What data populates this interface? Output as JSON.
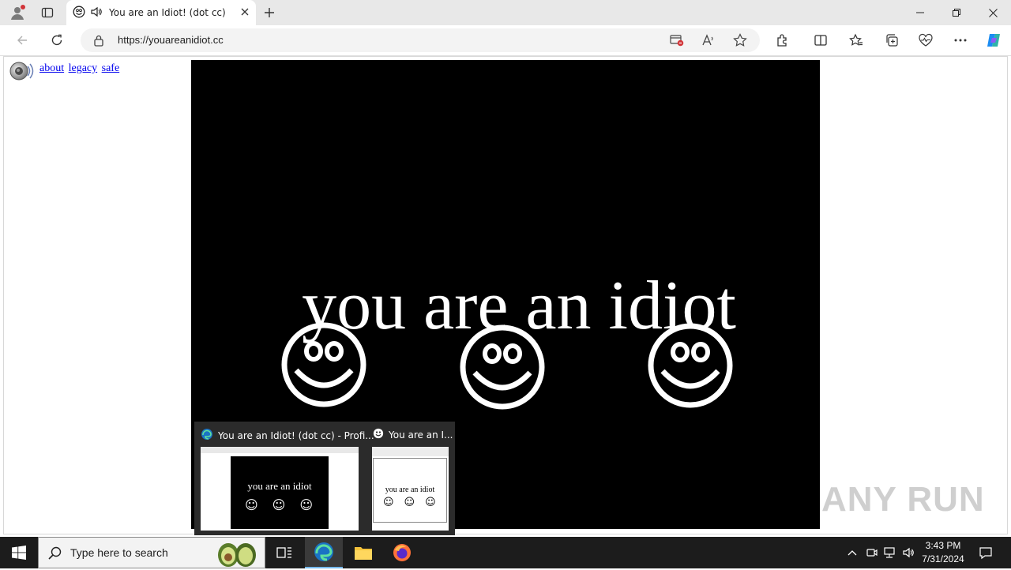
{
  "browser": {
    "tab": {
      "title": "You are an Idiot! (dot cc)"
    },
    "address": {
      "url": "https://youareanidiot.cc"
    }
  },
  "page": {
    "links": [
      "about",
      "legacy",
      "safe"
    ],
    "headline": "you are an idiot",
    "smiley_count": 3,
    "background": "#000000",
    "foreground": "#ffffff"
  },
  "watermark": "ANY RUN",
  "taskbar_preview": {
    "items": [
      {
        "title": "You are an Idiot! (dot cc) - Profi...",
        "icon": "edge-icon",
        "thumb_text": "you are an idiot"
      },
      {
        "title": "You are an I...",
        "icon": "smiley-icon",
        "thumb_text": "you are an idiot"
      }
    ]
  },
  "taskbar": {
    "search_placeholder": "Type here to search",
    "time": "3:43 PM",
    "date": "7/31/2024"
  },
  "colors": {
    "accent": "#0078d4",
    "taskbar": "#1c1c1c",
    "link": "#0000ee"
  }
}
